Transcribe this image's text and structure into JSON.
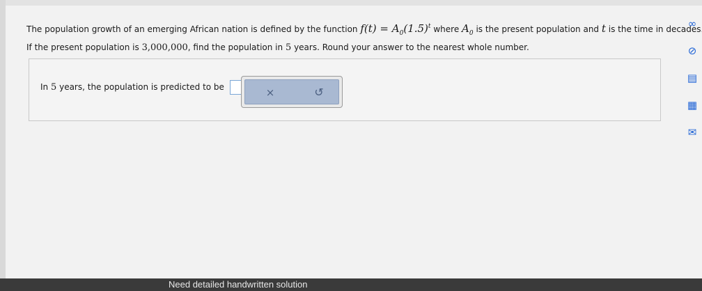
{
  "question": {
    "line1_pre": "The population growth of an emerging African nation is defined by the function",
    "function": "f(t) = A",
    "function_sub": "0",
    "function_base": "(1.5)",
    "function_exp": "t",
    "where_text": "where",
    "variable": "A",
    "variable_sub": "0",
    "line1_mid": "is the present population and",
    "t_var": "t",
    "line1_post": "is the time in decades.",
    "line2_pre": "If the present population is",
    "population": "3,000,000",
    "line2_mid": ", find the population in",
    "years": "5",
    "line2_post": "years. Round your answer to the nearest whole number."
  },
  "answer": {
    "pre": "In",
    "years": "5",
    "post": "years, the population is predicted to be",
    "value": "",
    "period": "."
  },
  "tools": {
    "clear_symbol": "×",
    "undo_symbol": "↺"
  },
  "side_icons": [
    "infinity-icon",
    "check-circle-icon",
    "notepad-icon",
    "calculator-icon",
    "mail-icon"
  ],
  "side_icon_glyphs": [
    "∞",
    "⊘",
    "▤",
    "▦",
    "✉"
  ],
  "accent_color": "#1f63d6",
  "caption": "Need detailed handwritten solution"
}
